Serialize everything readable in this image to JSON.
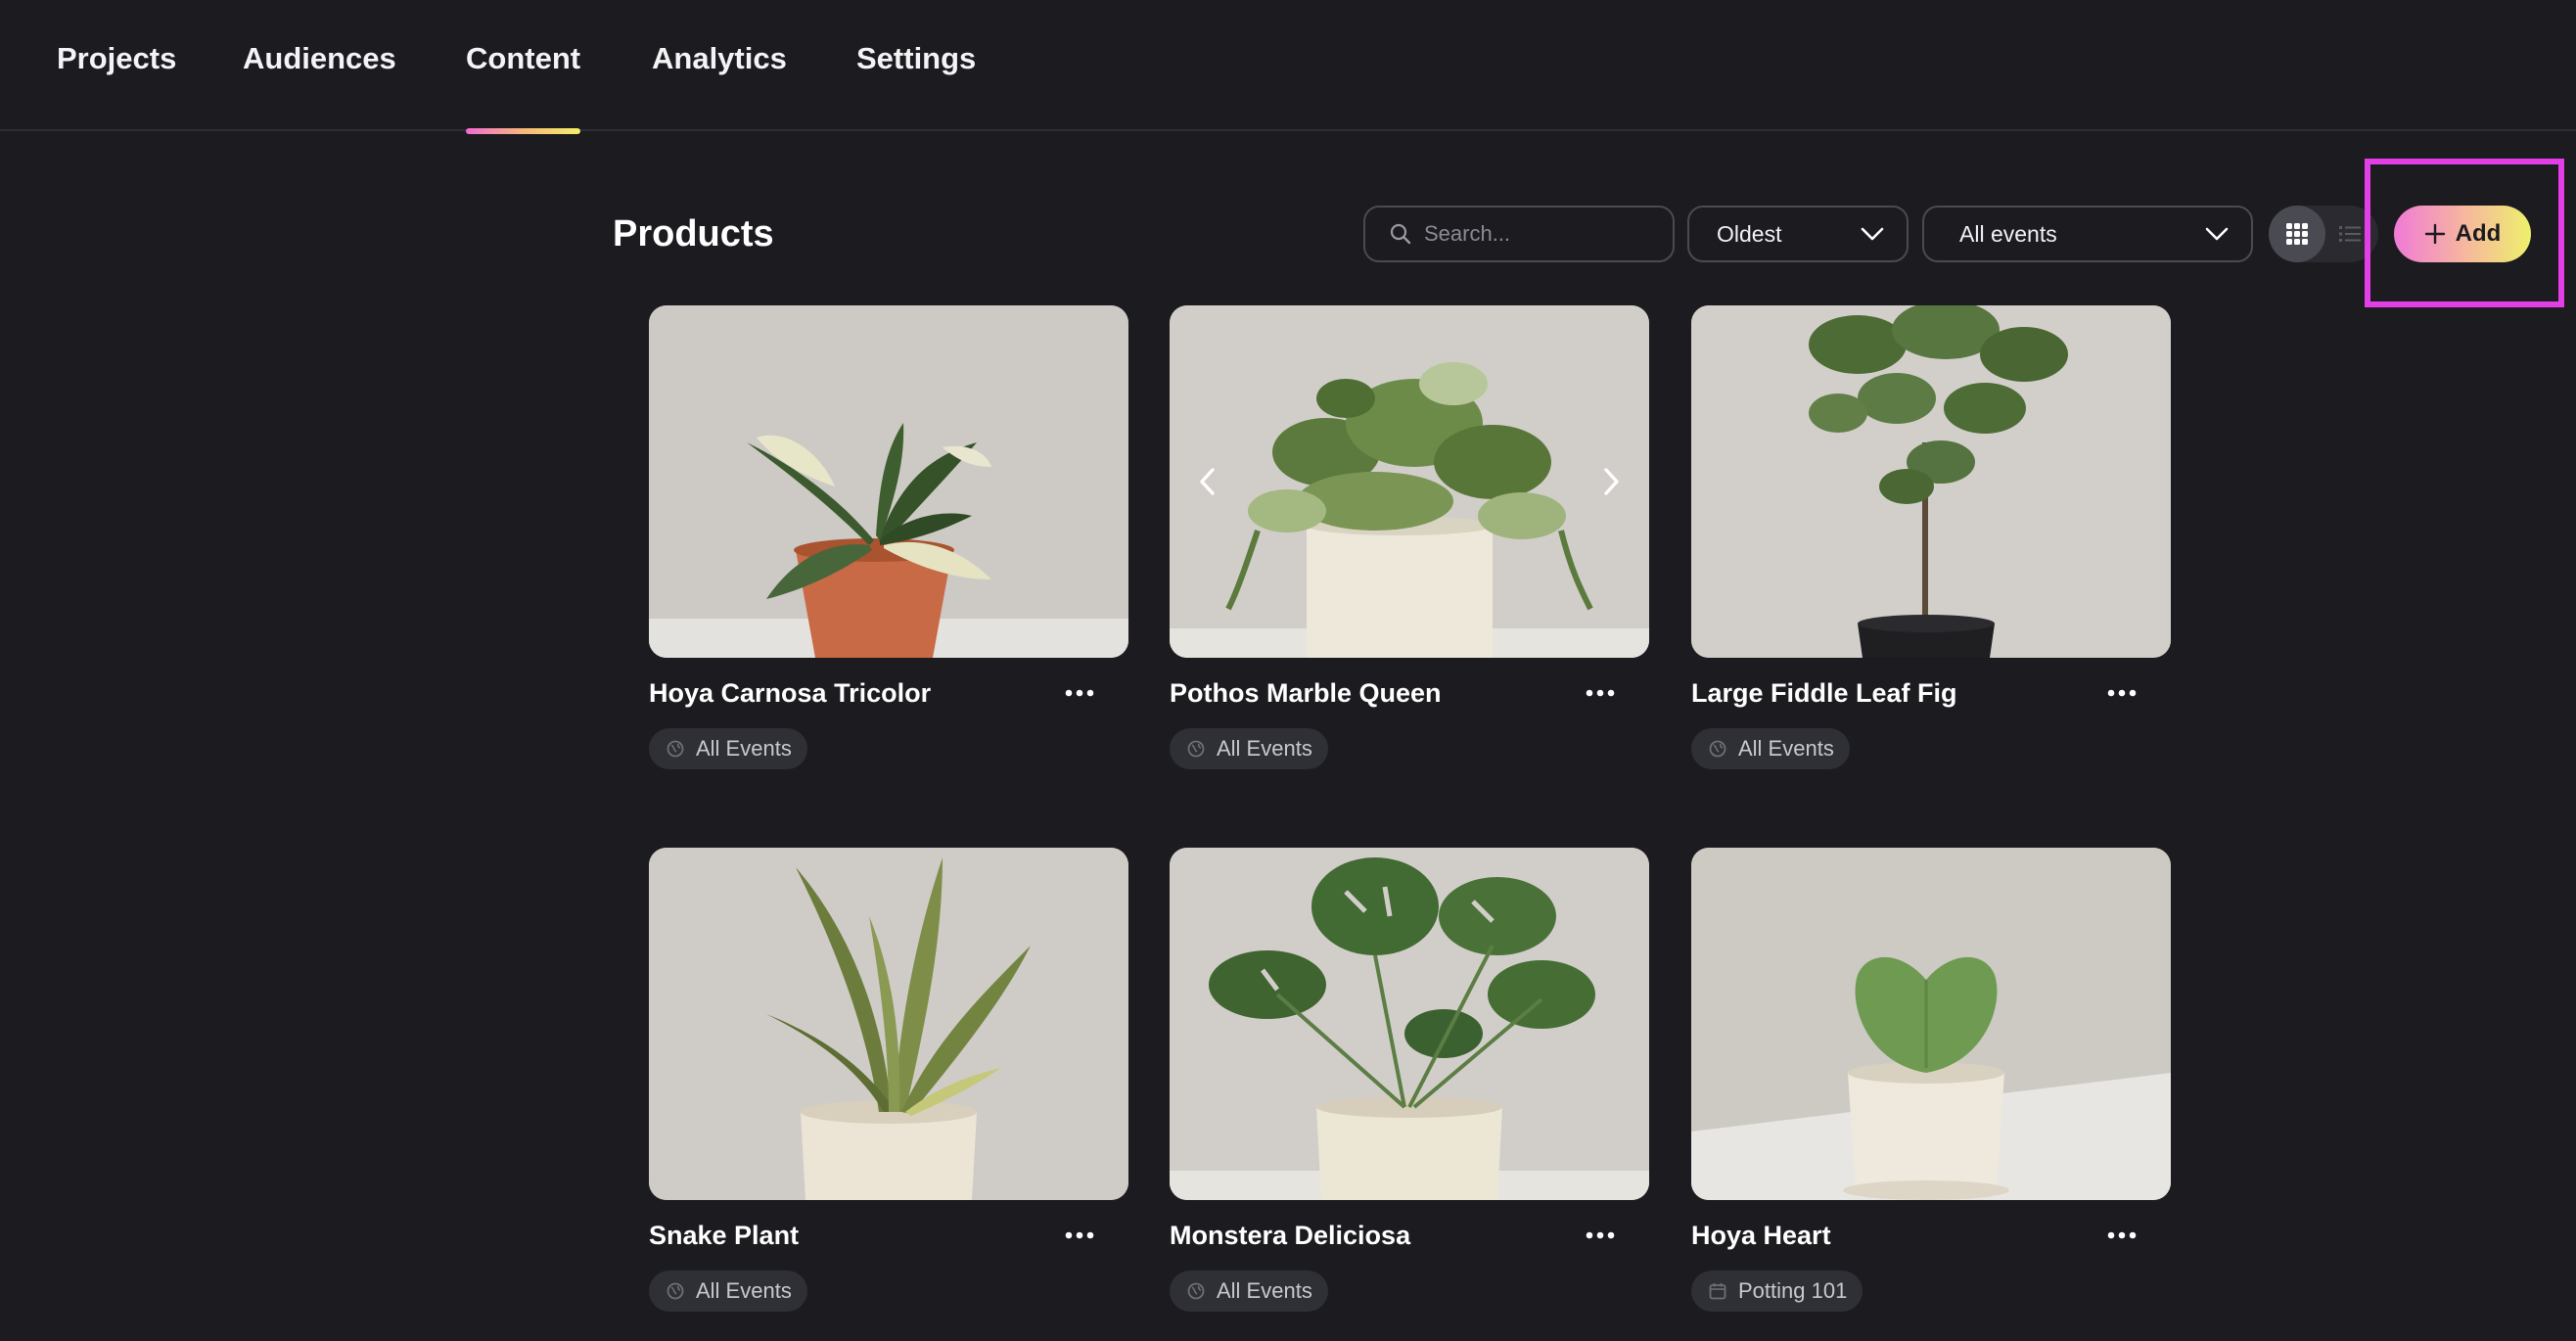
{
  "nav": {
    "tabs": [
      {
        "label": "Projects"
      },
      {
        "label": "Audiences"
      },
      {
        "label": "Content"
      },
      {
        "label": "Analytics"
      },
      {
        "label": "Settings"
      }
    ],
    "active_tab": "Content"
  },
  "toolbar": {
    "title": "Products",
    "search_placeholder": "Search...",
    "sort_value": "Oldest",
    "event_filter_value": "All events",
    "add_label": "Add",
    "view_mode": "grid"
  },
  "products": [
    {
      "name": "Hoya Carnosa Tricolor",
      "tag": "All Events",
      "tag_icon": "globe-icon"
    },
    {
      "name": "Pothos Marble Queen",
      "tag": "All Events",
      "tag_icon": "globe-icon"
    },
    {
      "name": "Large Fiddle Leaf Fig",
      "tag": "All Events",
      "tag_icon": "globe-icon"
    },
    {
      "name": "Snake Plant",
      "tag": "All Events",
      "tag_icon": "globe-icon"
    },
    {
      "name": "Monstera Deliciosa",
      "tag": "All Events",
      "tag_icon": "globe-icon"
    },
    {
      "name": "Hoya Heart",
      "tag": "Potting 101",
      "tag_icon": "calendar-icon"
    }
  ],
  "colors": {
    "background": "#1b1b20",
    "accent_gradient_start": "#f07ad6",
    "accent_gradient_end": "#eef06c",
    "highlight": "#e23fe6"
  }
}
